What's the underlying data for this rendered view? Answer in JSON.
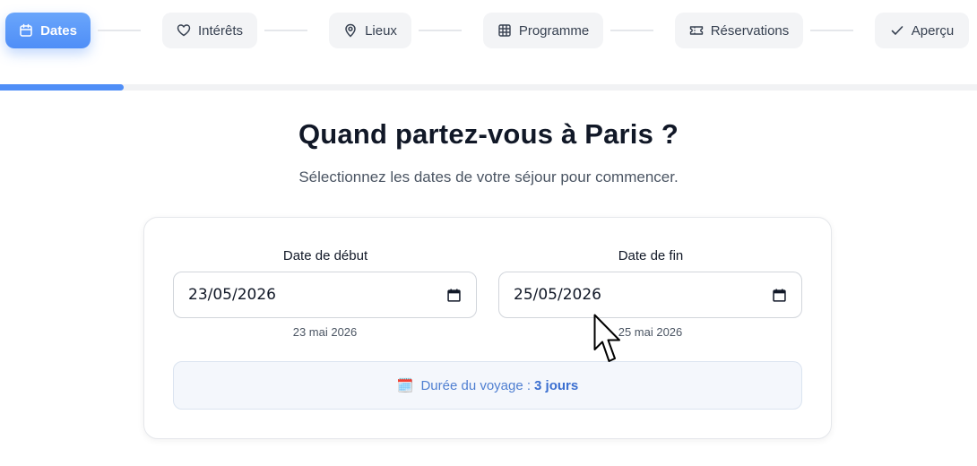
{
  "stepper": {
    "steps": [
      {
        "label": "Dates",
        "icon": "calendar-icon",
        "active": true
      },
      {
        "label": "Intérêts",
        "icon": "heart-icon",
        "active": false
      },
      {
        "label": "Lieux",
        "icon": "map-pin-icon",
        "active": false
      },
      {
        "label": "Programme",
        "icon": "grid-icon",
        "active": false
      },
      {
        "label": "Réservations",
        "icon": "ticket-icon",
        "active": false
      },
      {
        "label": "Aperçu",
        "icon": "check-icon",
        "active": false
      }
    ],
    "progress_fraction": 0.127
  },
  "main": {
    "title": "Quand partez-vous à Paris ?",
    "subtitle": "Sélectionnez les dates de votre séjour pour commencer."
  },
  "form": {
    "start": {
      "label": "Date de début",
      "value": "23/05/2026",
      "hint": "23 mai 2026"
    },
    "end": {
      "label": "Date de fin",
      "value": "25/05/2026",
      "hint": "25 mai 2026"
    },
    "duration": {
      "emoji": "🗓️",
      "label": "Durée du voyage :",
      "value": "3 jours"
    }
  },
  "colors": {
    "accent": "#4f8ef7",
    "step_bg": "#f3f4f6",
    "duration_text": "#4f7fd1",
    "duration_bg": "#f4f7fc"
  }
}
